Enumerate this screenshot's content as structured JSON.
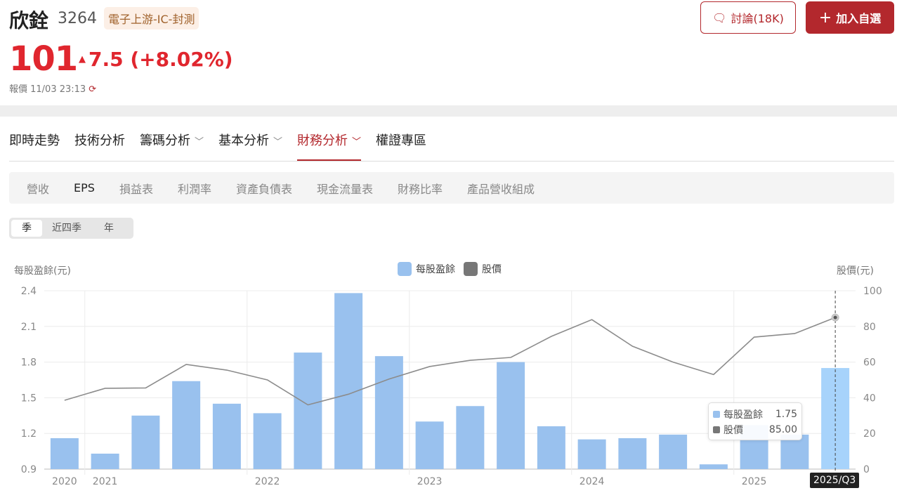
{
  "stock": {
    "name": "欣銓",
    "code": "3264",
    "industry": "電子上游-IC-封測",
    "price": "101",
    "change": "7.5",
    "change_pct": "(+8.02%)",
    "quote_label": "報價 11/03 23:13",
    "up_color": "#e0262e"
  },
  "actions": {
    "discuss": "討論(18K)",
    "watchlist": "加入自選"
  },
  "nav": {
    "items": [
      {
        "label": "即時走勢"
      },
      {
        "label": "技術分析"
      },
      {
        "label": "籌碼分析",
        "dropdown": true
      },
      {
        "label": "基本分析",
        "dropdown": true
      },
      {
        "label": "財務分析",
        "dropdown": true,
        "active": true
      },
      {
        "label": "權證專區"
      }
    ]
  },
  "subnav": {
    "items": [
      "營收",
      "EPS",
      "損益表",
      "利潤率",
      "資產負債表",
      "現金流量表",
      "財務比率",
      "產品營收組成"
    ],
    "active": "EPS"
  },
  "period": {
    "options": [
      "季",
      "近四季",
      "年"
    ],
    "selected": "季"
  },
  "tooltip": {
    "period": "2025/Q3",
    "eps_label": "每股盈餘",
    "eps_value": "1.75",
    "price_label": "股價",
    "price_value": "85.00"
  },
  "chart_data": {
    "type": "bar+line",
    "ylabel_left": "每股盈餘(元)",
    "ylabel_right": "股價(元)",
    "legend": [
      "每股盈餘",
      "股價"
    ],
    "legend_placement": "top-center",
    "categories": [
      "2020/Q4",
      "2021/Q1",
      "2021/Q2",
      "2021/Q3",
      "2021/Q4",
      "2022/Q1",
      "2022/Q2",
      "2022/Q3",
      "2022/Q4",
      "2023/Q1",
      "2023/Q2",
      "2023/Q3",
      "2023/Q4",
      "2024/Q1",
      "2024/Q2",
      "2024/Q3",
      "2024/Q4",
      "2025/Q1",
      "2025/Q2",
      "2025/Q3"
    ],
    "x_year_labels": [
      {
        "index": 0,
        "label": "2020"
      },
      {
        "index": 1,
        "label": "2021"
      },
      {
        "index": 5,
        "label": "2022"
      },
      {
        "index": 9,
        "label": "2023"
      },
      {
        "index": 13,
        "label": "2024"
      },
      {
        "index": 17,
        "label": "2025"
      }
    ],
    "series": [
      {
        "name": "每股盈餘",
        "type": "bar",
        "axis": "left",
        "color": "#99c1ee",
        "values": [
          1.16,
          1.03,
          1.35,
          1.64,
          1.45,
          1.37,
          1.88,
          2.38,
          1.85,
          1.3,
          1.43,
          1.8,
          1.26,
          1.15,
          1.16,
          1.19,
          0.94,
          1.27,
          1.19,
          1.75
        ]
      },
      {
        "name": "股價",
        "type": "line",
        "axis": "right",
        "color": "#8c8c8c",
        "values": [
          38.6,
          45.3,
          45.5,
          58.7,
          55.5,
          50,
          36,
          42,
          50.5,
          57.5,
          61,
          62.6,
          74.4,
          83.8,
          68.9,
          60,
          53,
          74,
          76,
          85
        ]
      }
    ],
    "ylim_left": [
      0.9,
      2.4
    ],
    "yticks_left": [
      "0.9",
      "1.2",
      "1.5",
      "1.8",
      "2.1",
      "2.4"
    ],
    "ylim_right": [
      0,
      100
    ],
    "yticks_right": [
      "0",
      "20",
      "40",
      "60",
      "80",
      "100"
    ],
    "grid": true,
    "highlight_index": 19
  }
}
